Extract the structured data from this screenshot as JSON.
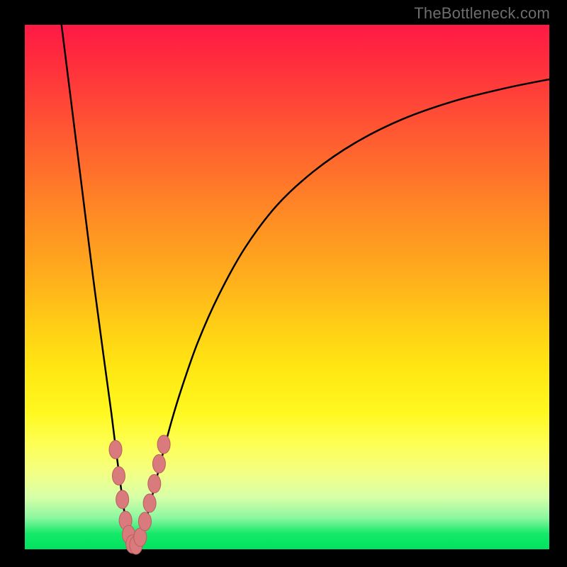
{
  "attribution": "TheBottleneck.com",
  "colors": {
    "gradient_top": "#ff1a45",
    "gradient_mid_orange": "#ff8a25",
    "gradient_mid_yellow": "#ffe812",
    "gradient_bottom": "#00e35e",
    "curve": "#000000",
    "markers": "#d97a7d",
    "marker_stroke": "#b95e61",
    "frame": "#000000"
  },
  "chart_data": {
    "type": "line",
    "title": "",
    "xlabel": "",
    "ylabel": "",
    "xlim": [
      0,
      100
    ],
    "ylim": [
      0,
      100
    ],
    "series": [
      {
        "name": "bottleneck-curve",
        "x": [
          7,
          9,
          11,
          13,
          15,
          16.5,
          17.5,
          18.3,
          19,
          19.6,
          20.2,
          20.8,
          21.4,
          22,
          23,
          24,
          25,
          26,
          28,
          30,
          33,
          37,
          42,
          48,
          55,
          63,
          72,
          82,
          92,
          100
        ],
        "values": [
          100,
          84,
          68,
          52,
          37,
          26,
          18,
          12,
          7,
          3.5,
          1.2,
          0.2,
          0.8,
          2,
          5.2,
          9,
          13,
          17,
          24.5,
          31,
          39.5,
          48.5,
          57.5,
          65.5,
          72,
          77.5,
          82,
          85.5,
          88,
          89.6
        ]
      }
    ],
    "markers": {
      "name": "highlighted-points",
      "points": [
        {
          "x": 17.3,
          "y": 19
        },
        {
          "x": 17.9,
          "y": 14
        },
        {
          "x": 18.6,
          "y": 9.5
        },
        {
          "x": 19.2,
          "y": 5.5
        },
        {
          "x": 19.8,
          "y": 2.8
        },
        {
          "x": 20.5,
          "y": 1.0
        },
        {
          "x": 21.2,
          "y": 0.8
        },
        {
          "x": 22.0,
          "y": 2.3
        },
        {
          "x": 22.9,
          "y": 5.3
        },
        {
          "x": 23.8,
          "y": 8.8
        },
        {
          "x": 24.7,
          "y": 12.5
        },
        {
          "x": 25.6,
          "y": 16.3
        },
        {
          "x": 26.5,
          "y": 20.0
        }
      ]
    }
  }
}
